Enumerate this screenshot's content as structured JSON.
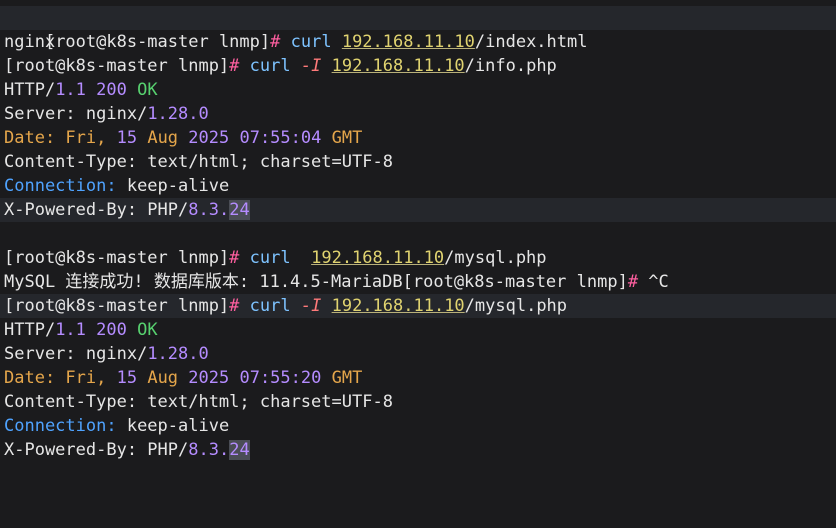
{
  "session1": {
    "prompt": "[root@k8s-master lnmp]",
    "hash": "#",
    "cmd": "curl",
    "space_after_cmd": " ",
    "url": "192.168.11.10",
    "path": "/index.html",
    "output": "nginx"
  },
  "session2": {
    "prompt": "[root@k8s-master lnmp]",
    "hash": "#",
    "cmd": "curl",
    "flag": "-I",
    "url": "192.168.11.10",
    "path": "/info.php",
    "http": "HTTP/",
    "http_ver": "1.1",
    "status": "200",
    "ok": "OK",
    "server_key": "Server:",
    "server_val": " nginx/",
    "server_ver": "1.28.0",
    "date_key": "Date:",
    "date_day": " Fri, ",
    "date_num": "15",
    "date_mon": " Aug ",
    "date_year": "2025",
    "date_time": " 07:55:04 ",
    "date_tz": "GMT",
    "ctype": "Content-Type: text/html; charset=UTF-8",
    "conn_key": "Connection:",
    "conn_val": " keep-alive",
    "xpb_key": "X-Powered-By:",
    "xpb_val": " PHP/",
    "php_ver": "8.3.",
    "php_cursor": "24"
  },
  "session3": {
    "prompt": "[root@k8s-master lnmp]",
    "hash": "#",
    "cmd": "curl",
    "url": "192.168.11.10",
    "path": "/mysql.php",
    "mysql_output": "MySQL 连接成功! 数据库版本: 11.4.5-MariaDB",
    "prompt2": "[root@k8s-master lnmp]",
    "hash2": "#",
    "ctrl_c": " ^C"
  },
  "session4": {
    "prompt": "[root@k8s-master lnmp]",
    "hash": "#",
    "cmd": "curl",
    "flag": "-I",
    "url": "192.168.11.10",
    "path": "/mysql.php",
    "http": "HTTP/",
    "http_ver": "1.1",
    "status": "200",
    "ok": "OK",
    "server_key": "Server:",
    "server_val": " nginx/",
    "server_ver": "1.28.0",
    "date_key": "Date:",
    "date_day": " Fri, ",
    "date_num": "15",
    "date_mon": " Aug ",
    "date_year": "2025",
    "date_time": " 07:55:20 ",
    "date_tz": "GMT",
    "ctype": "Content-Type: text/html; charset=UTF-8",
    "conn_key": "Connection:",
    "conn_val": " keep-alive",
    "xpb_key": "X-Powered-By:",
    "xpb_val": " PHP/",
    "php_ver": "8.3.",
    "php_cursor": "24"
  },
  "colors": {
    "background": "#1b1b1d",
    "highlight_row": "#25272c",
    "prompt_hash": "#ff5fa0",
    "command": "#7ec3ff",
    "url": "#e0d370",
    "number": "#b58cff",
    "ok": "#57d16f",
    "header_orange": "#e5a64b",
    "header_cyan": "#4fa3ff"
  }
}
